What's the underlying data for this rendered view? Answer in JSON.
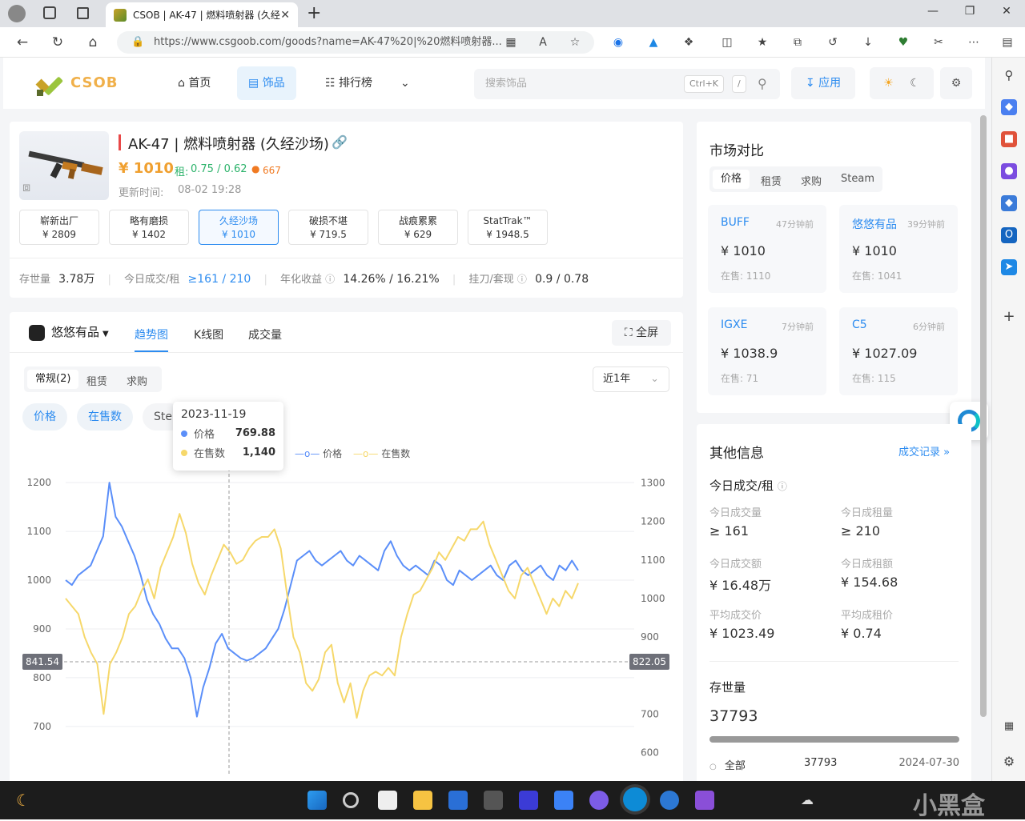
{
  "browser": {
    "tab_title": "CSOB | AK-47 | 燃料喷射器 (久经",
    "url": "https://www.csgoob.com/goods?name=AK-47%20|%20燃料喷射器...",
    "tab_close": "✕",
    "new_tab": "+"
  },
  "header": {
    "logo_text": "CSOB",
    "nav": [
      "首页",
      "饰品",
      "排行榜"
    ],
    "search_placeholder": "搜索饰品",
    "shortcut": "Ctrl+K",
    "slash": "/",
    "apply_label": "应用"
  },
  "item": {
    "name": "AK-47 | 燃料喷射器 (久经沙场)",
    "price": "¥ 1010",
    "rent_label": "租:",
    "rent": "0.75 / 0.62",
    "hot": "667",
    "update_label": "更新时间:",
    "update_time": "08-02 19:28",
    "wears": [
      {
        "name": "崭新出厂",
        "price": "¥ 2809"
      },
      {
        "name": "略有磨损",
        "price": "¥ 1402"
      },
      {
        "name": "久经沙场",
        "price": "¥ 1010"
      },
      {
        "name": "破损不堪",
        "price": "¥ 719.5"
      },
      {
        "name": "战痕累累",
        "price": "¥ 629"
      },
      {
        "name": "StatTrak™",
        "price": "¥ 1948.5"
      }
    ],
    "stats": [
      {
        "label": "存世量",
        "value": "3.78万"
      },
      {
        "label": "今日成交/租",
        "value": "≥161 / 210"
      },
      {
        "label": "年化收益",
        "value": "14.26% / 16.21%"
      },
      {
        "label": "挂刀/套现",
        "value": "0.9 / 0.78"
      }
    ]
  },
  "chart_panel": {
    "platform": "悠悠有品",
    "tabs": [
      "趋势图",
      "K线图",
      "成交量"
    ],
    "fullscreen": "全屏",
    "subtabs": [
      "常规(2)",
      "租赁",
      "求购"
    ],
    "range": "近1年",
    "pills": [
      "价格",
      "在售数",
      "Ste"
    ],
    "legend": [
      "价格",
      "在售数"
    ],
    "tooltip": {
      "date": "2023-11-19",
      "price_label": "价格",
      "price": "769.88",
      "count_label": "在售数",
      "count": "1,140"
    },
    "left_marker": "841.54",
    "right_marker": "822.05"
  },
  "chart_data": {
    "type": "line",
    "x_range": [
      "2023-08",
      "2024-08"
    ],
    "series": [
      {
        "name": "价格",
        "axis": "left",
        "color": "#5b8ff9",
        "values": [
          1000,
          990,
          1010,
          1020,
          1030,
          1060,
          1090,
          1200,
          1130,
          1110,
          1080,
          1050,
          1010,
          960,
          930,
          910,
          880,
          860,
          860,
          840,
          800,
          720,
          780,
          820,
          870,
          890,
          860,
          850,
          840,
          835,
          840,
          850,
          860,
          880,
          900,
          940,
          990,
          1040,
          1050,
          1060,
          1040,
          1030,
          1040,
          1050,
          1060,
          1040,
          1030,
          1050,
          1040,
          1030,
          1020,
          1060,
          1080,
          1050,
          1030,
          1020,
          1030,
          1020,
          1010,
          1040,
          1030,
          1000,
          990,
          1020,
          1010,
          1000,
          1010,
          1020,
          1030,
          1010,
          1000,
          1030,
          1040,
          1020,
          1010,
          1020,
          1030,
          1010,
          1000,
          1030,
          1020,
          1040,
          1020
        ]
      },
      {
        "name": "在售数",
        "axis": "right",
        "color": "#f6d86b",
        "values": [
          1000,
          980,
          960,
          900,
          860,
          830,
          700,
          830,
          860,
          900,
          960,
          980,
          1020,
          1050,
          1000,
          1080,
          1120,
          1160,
          1220,
          1170,
          1090,
          1040,
          1010,
          1060,
          1100,
          1140,
          1120,
          1090,
          1100,
          1130,
          1150,
          1160,
          1160,
          1180,
          1130,
          1010,
          900,
          860,
          780,
          760,
          790,
          860,
          880,
          780,
          730,
          780,
          690,
          760,
          800,
          810,
          800,
          820,
          800,
          900,
          960,
          1010,
          1020,
          1050,
          1080,
          1120,
          1100,
          1130,
          1160,
          1150,
          1180,
          1180,
          1200,
          1140,
          1100,
          1060,
          1020,
          1000,
          1060,
          1080,
          1040,
          1000,
          960,
          1000,
          980,
          1020,
          1000,
          1040
        ]
      }
    ],
    "left_ticks": [
      700,
      800,
      900,
      1000,
      1100,
      1200
    ],
    "right_ticks": [
      600,
      700,
      900,
      1000,
      1100,
      1200,
      1300
    ],
    "ylim_left": [
      680,
      1215
    ],
    "ylim_right": [
      580,
      1320
    ]
  },
  "market": {
    "title": "市场对比",
    "tabs": [
      "价格",
      "租赁",
      "求购",
      "Steam"
    ],
    "cards": [
      {
        "name": "BUFF",
        "time": "47分钟前",
        "price": "¥ 1010",
        "stock": "在售: 1110"
      },
      {
        "name": "悠悠有品",
        "time": "39分钟前",
        "price": "¥ 1010",
        "stock": "在售: 1041"
      },
      {
        "name": "IGXE",
        "time": "7分钟前",
        "price": "¥ 1038.9",
        "stock": "在售: 71"
      },
      {
        "name": "C5",
        "time": "6分钟前",
        "price": "¥ 1027.09",
        "stock": "在售: 115"
      }
    ]
  },
  "other": {
    "title": "其他信息",
    "link": "成交记录 »",
    "section": "今日成交/租",
    "items": [
      {
        "label": "今日成交量",
        "value": "≥ 161"
      },
      {
        "label": "今日成租量",
        "value": "≥ 210"
      },
      {
        "label": "今日成交额",
        "value": "¥ 16.48万"
      },
      {
        "label": "今日成租额",
        "value": "¥ 154.68"
      },
      {
        "label": "平均成交价",
        "value": "¥ 1023.49"
      },
      {
        "label": "平均成租价",
        "value": "¥ 0.74"
      }
    ],
    "existence_label": "存世量",
    "existence": "37793",
    "row": {
      "label": "全部",
      "value": "37793",
      "date": "2024-07-30"
    }
  },
  "watermark": "小黑盒"
}
